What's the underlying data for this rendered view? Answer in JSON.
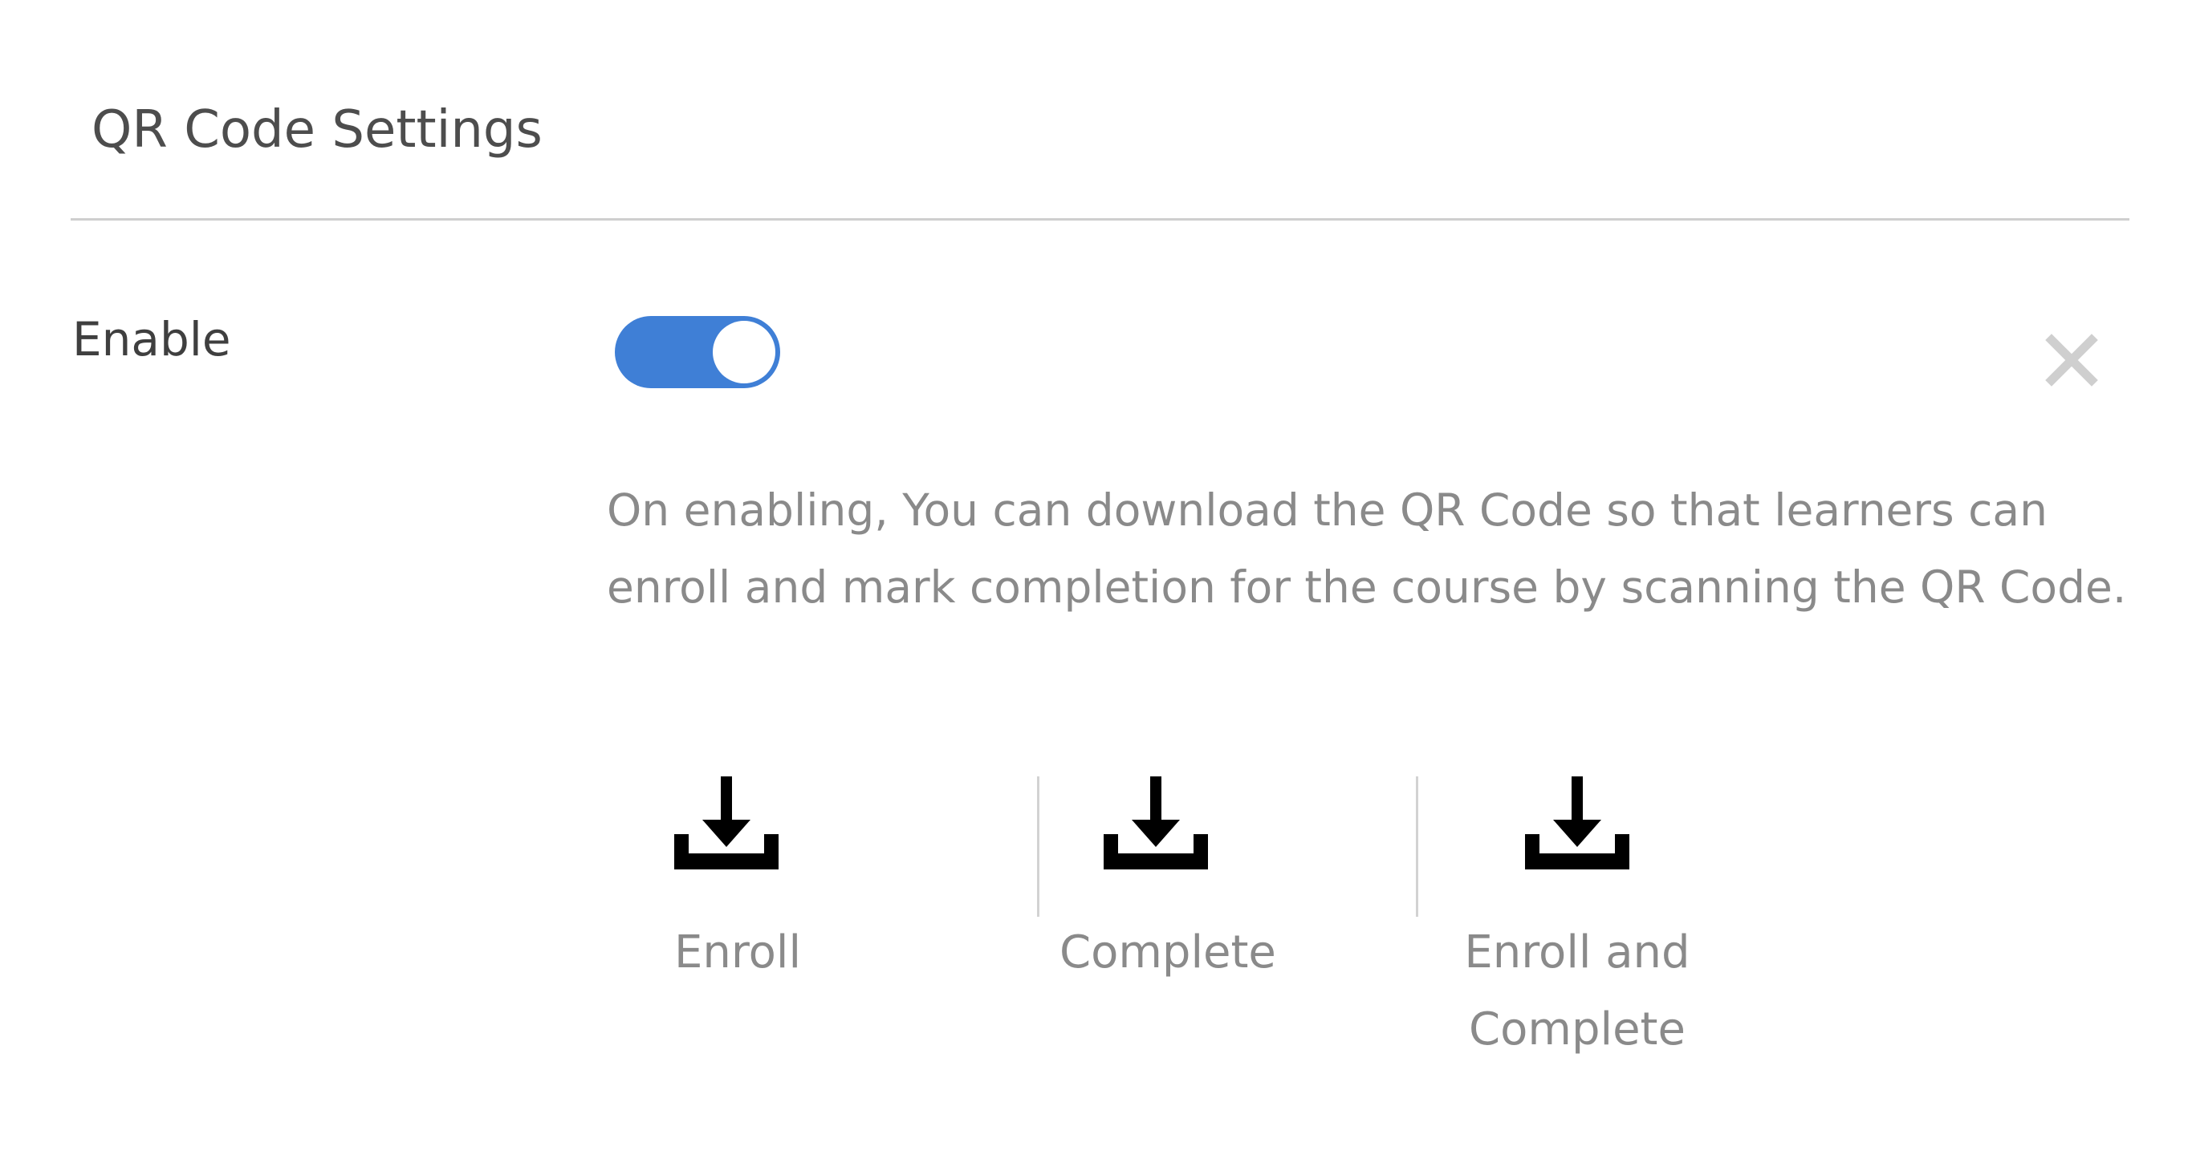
{
  "section": {
    "title": "QR Code Settings"
  },
  "enable": {
    "label": "Enable",
    "toggle_on": true,
    "toggle_color": "#3f7fd6"
  },
  "close": {
    "icon": "close-icon"
  },
  "description": "On enabling, You can download the QR Code so that learners can enroll and mark completion for the course by scanning the QR Code.",
  "downloads": [
    {
      "label": "Enroll",
      "icon": "download-icon"
    },
    {
      "label": "Complete",
      "icon": "download-icon"
    },
    {
      "label": "Enroll and Complete",
      "icon": "download-icon"
    }
  ]
}
